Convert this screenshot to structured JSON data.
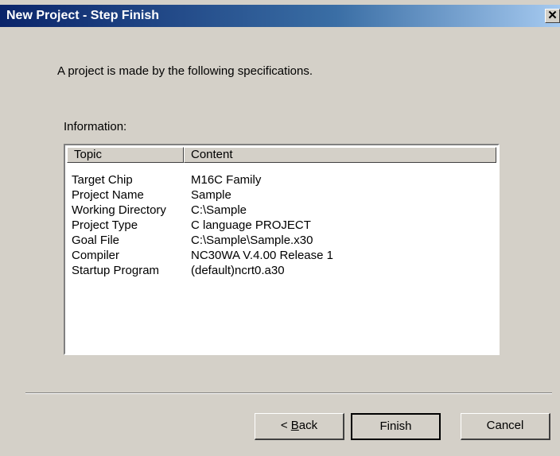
{
  "window": {
    "title": "New Project - Step Finish",
    "close_glyph": "✕"
  },
  "intro_text": "A project is made by the following specifications.",
  "info_label": "Information:",
  "table": {
    "columns": [
      "Topic",
      "Content"
    ],
    "rows": [
      {
        "topic": "Target Chip",
        "content": "M16C Family"
      },
      {
        "topic": "Project Name",
        "content": "Sample"
      },
      {
        "topic": "Working Directory",
        "content": "C:\\Sample"
      },
      {
        "topic": "Project Type",
        "content": "C language PROJECT"
      },
      {
        "topic": "Goal File",
        "content": "C:\\Sample\\Sample.x30"
      },
      {
        "topic": "Compiler",
        "content": "NC30WA V.4.00 Release 1"
      },
      {
        "topic": "Startup Program",
        "content": "(default)ncrt0.a30"
      }
    ]
  },
  "buttons": {
    "back_prefix": "< ",
    "back_mnemonic": "B",
    "back_rest": "ack",
    "finish": "Finish",
    "cancel": "Cancel"
  }
}
